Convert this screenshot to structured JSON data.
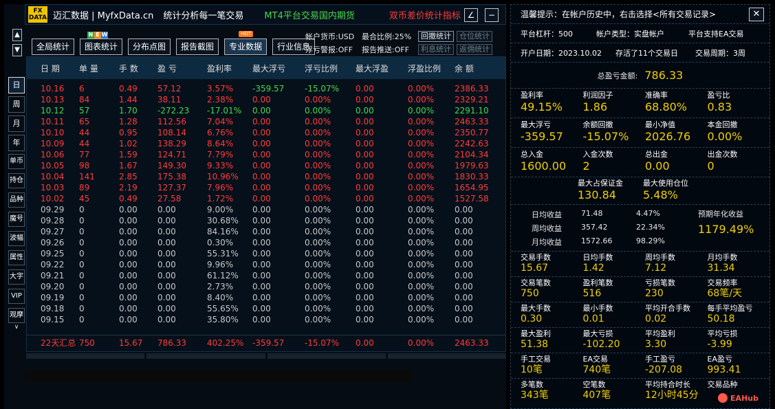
{
  "title": {
    "logo_top": "FX",
    "logo_bottom": "DATA",
    "brand": "迈汇数据 | MyfxData.cn",
    "desc": "统计分析每一笔交易",
    "ad_green": "MT4平台交易国内期货",
    "ad_red": "双币差价统计指标",
    "edit_icon": "∠",
    "minimize_icon": "−"
  },
  "nav_arrows": {
    "up": "▲",
    "down": "▼"
  },
  "toolbar": {
    "new_badge": [
      "N",
      "E",
      "W"
    ],
    "hot_badge": "HOT",
    "buttons": [
      "全局统计",
      "图表统计",
      "分布点图",
      "报告截图",
      "专业数据",
      "行业信息"
    ]
  },
  "account": {
    "currency": "帐户货币:USD",
    "ratio": "最合比例:25%",
    "float_alert": "浮亏警报:OFF",
    "report_push": "报告推送:OFF",
    "btn_withdraw": "回撤统计",
    "btn_position": "仓位统计",
    "btn_interest": "利息统计",
    "btn_rebate": "返佣统计"
  },
  "left_tabs": [
    "日",
    "周",
    "月",
    "年",
    "单币",
    "持仓",
    "品种",
    "魔号",
    "波幅",
    "属性",
    "大字",
    "VIP",
    "观摩",
    "∨"
  ],
  "table": {
    "headers": [
      "日 期",
      "单 量",
      "手 数",
      "盈 亏",
      "盈利率",
      "最大浮亏",
      "浮亏比例",
      "最大浮盈",
      "浮盈比例",
      "余 额"
    ],
    "rows": [
      {
        "s": "pos",
        "c": [
          "10.16",
          "6",
          "0.49",
          "57.12",
          "3.57%",
          "-359.57",
          "-15.07%",
          "0.00",
          "0.00%",
          "2386.33"
        ]
      },
      {
        "s": "pos",
        "c": [
          "10.13",
          "84",
          "1.44",
          "38.11",
          "2.38%",
          "0.00",
          "0.00%",
          "0.00",
          "0.00%",
          "2329.21"
        ]
      },
      {
        "s": "neg",
        "c": [
          "10.12",
          "57",
          "1.70",
          "-272.23",
          "-17.01%",
          "0.00",
          "0.00%",
          "0.00",
          "0.00%",
          "2291.10"
        ]
      },
      {
        "s": "pos",
        "c": [
          "10.11",
          "65",
          "1.28",
          "112.56",
          "7.04%",
          "0.00",
          "0.00%",
          "0.00",
          "0.00%",
          "2463.33"
        ]
      },
      {
        "s": "pos",
        "c": [
          "10.10",
          "44",
          "0.95",
          "108.14",
          "6.76%",
          "0.00",
          "0.00%",
          "0.00",
          "0.00%",
          "2350.77"
        ]
      },
      {
        "s": "pos",
        "c": [
          "10.09",
          "44",
          "1.02",
          "138.29",
          "8.64%",
          "0.00",
          "0.00%",
          "0.00",
          "0.00%",
          "2242.63"
        ]
      },
      {
        "s": "pos",
        "c": [
          "10.06",
          "77",
          "1.59",
          "124.71",
          "7.79%",
          "0.00",
          "0.00%",
          "0.00",
          "0.00%",
          "2104.34"
        ]
      },
      {
        "s": "pos",
        "c": [
          "10.05",
          "98",
          "1.67",
          "149.30",
          "9.33%",
          "0.00",
          "0.00%",
          "0.00",
          "0.00%",
          "1979.63"
        ]
      },
      {
        "s": "pos",
        "c": [
          "10.04",
          "141",
          "2.85",
          "175.38",
          "10.96%",
          "0.00",
          "0.00%",
          "0.00",
          "0.00%",
          "1830.33"
        ]
      },
      {
        "s": "pos",
        "c": [
          "10.03",
          "89",
          "2.19",
          "127.37",
          "7.96%",
          "0.00",
          "0.00%",
          "0.00",
          "0.00%",
          "1654.95"
        ]
      },
      {
        "s": "pos",
        "c": [
          "10.02",
          "45",
          "0.49",
          "27.58",
          "1.72%",
          "0.00",
          "0.00%",
          "0.00",
          "0.00%",
          "1527.58"
        ]
      },
      {
        "s": "neu",
        "c": [
          "09.29",
          "0",
          "0.00",
          "0.00",
          "9.00%",
          "0.00",
          "0.00%",
          "0.00",
          "0.00%",
          "0.00"
        ]
      },
      {
        "s": "neu",
        "c": [
          "09.28",
          "0",
          "0.00",
          "0.00",
          "30.68%",
          "0.00",
          "0.00%",
          "0.00",
          "0.00%",
          "0.00"
        ]
      },
      {
        "s": "neu",
        "c": [
          "09.27",
          "0",
          "0.00",
          "0.00",
          "84.16%",
          "0.00",
          "0.00%",
          "0.00",
          "0.00%",
          "0.00"
        ]
      },
      {
        "s": "neu",
        "c": [
          "09.26",
          "0",
          "0.00",
          "0.00",
          "0.30%",
          "0.00",
          "0.00%",
          "0.00",
          "0.00%",
          "0.00"
        ]
      },
      {
        "s": "neu",
        "c": [
          "09.25",
          "0",
          "0.00",
          "0.00",
          "55.31%",
          "0.00",
          "0.00%",
          "0.00",
          "0.00%",
          "0.00"
        ]
      },
      {
        "s": "neu",
        "c": [
          "09.22",
          "0",
          "0.00",
          "0.00",
          "9.96%",
          "0.00",
          "0.00%",
          "0.00",
          "0.00%",
          "0.00"
        ]
      },
      {
        "s": "neu",
        "c": [
          "09.21",
          "0",
          "0.00",
          "0.00",
          "61.12%",
          "0.00",
          "0.00%",
          "0.00",
          "0.00%",
          "0.00"
        ]
      },
      {
        "s": "neu",
        "c": [
          "09.20",
          "0",
          "0.00",
          "0.00",
          "2.73%",
          "0.00",
          "0.00%",
          "0.00",
          "0.00%",
          "0.00"
        ]
      },
      {
        "s": "neu",
        "c": [
          "09.19",
          "0",
          "0.00",
          "0.00",
          "8.40%",
          "0.00",
          "0.00%",
          "0.00",
          "0.00%",
          "0.00"
        ]
      },
      {
        "s": "neu",
        "c": [
          "09.18",
          "0",
          "0.00",
          "0.00",
          "55.65%",
          "0.00",
          "0.00%",
          "0.00",
          "0.00%",
          "0.00"
        ]
      },
      {
        "s": "neu",
        "c": [
          "09.15",
          "0",
          "0.00",
          "0.00",
          "35.80%",
          "0.00",
          "0.00%",
          "0.00",
          "0.00%",
          "0.00"
        ]
      }
    ],
    "summary": [
      "22天汇总",
      "750",
      "15.67",
      "786.33",
      "402.25%",
      "-359.57",
      "-15.07%",
      "0.00",
      "0.00%",
      "2463.33"
    ]
  },
  "right": {
    "tip": "温馨提示：在帐户历史中，右击选择<所有交易记录>",
    "close_icon": "✕",
    "leverage": "平台杠杆：500",
    "acct_type": "帐户类型：实盘帐户",
    "ea_support": "平台支持EA交易",
    "open_date": "开户日期：2023.10.02",
    "survive": "存活了11个交易日",
    "period": "交易周期：3周",
    "total_label": "总盈亏金额:",
    "total_value": "786.33",
    "stats1": [
      {
        "k": "盈利率",
        "v": "49.15%"
      },
      {
        "k": "利润因子",
        "v": "1.86"
      },
      {
        "k": "准确率",
        "v": "68.80%"
      },
      {
        "k": "盈亏比",
        "v": "0.83"
      }
    ],
    "stats2": [
      {
        "k": "最大浮亏",
        "v": "-359.57"
      },
      {
        "k": "余额回撤",
        "v": "-15.07%"
      },
      {
        "k": "最小净值",
        "v": "2026.76"
      },
      {
        "k": "本金回撤",
        "v": "0.00%"
      }
    ],
    "stats3": [
      {
        "k": "总入金",
        "v": "1600.00"
      },
      {
        "k": "入金次数",
        "v": "2"
      },
      {
        "k": "总出金",
        "v": "0.00"
      },
      {
        "k": "出金次数",
        "v": "0"
      }
    ],
    "stats4": [
      {
        "k": "最大占保证金",
        "v": "130.84"
      },
      {
        "k": "最大使用仓位",
        "v": "5.48%"
      }
    ],
    "avg": [
      {
        "k": "日均收益",
        "a": "71.48",
        "b": "4.47%"
      },
      {
        "k": "周均收益",
        "a": "357.42",
        "b": "22.34%"
      },
      {
        "k": "月均收益",
        "a": "1572.66",
        "b": "98.29%"
      }
    ],
    "proj_label": "预期年化收益",
    "proj_value": "1179.49%",
    "stats5": [
      {
        "k": "交易手数",
        "v": "15.67"
      },
      {
        "k": "日均手数",
        "v": "1.42"
      },
      {
        "k": "周均手数",
        "v": "7.12"
      },
      {
        "k": "月均手数",
        "v": "31.34"
      }
    ],
    "stats6": [
      {
        "k": "交易笔数",
        "v": "750"
      },
      {
        "k": "盈利笔数",
        "v": "516"
      },
      {
        "k": "亏损笔数",
        "v": "230"
      },
      {
        "k": "交易频率",
        "v": "68笔/天"
      }
    ],
    "stats7": [
      {
        "k": "最大手数",
        "v": "0.30"
      },
      {
        "k": "最小手数",
        "v": "0.01"
      },
      {
        "k": "平均开合手数",
        "v": "0.02"
      },
      {
        "k": "每手平均盈亏",
        "v": "50.18"
      }
    ],
    "stats8": [
      {
        "k": "最大盈利",
        "v": "51.38"
      },
      {
        "k": "最大亏损",
        "v": "-102.20"
      },
      {
        "k": "平均盈利",
        "v": "3.30"
      },
      {
        "k": "平均亏损",
        "v": "-3.99"
      }
    ],
    "stats9": [
      {
        "k": "手工交易",
        "v": "10笔"
      },
      {
        "k": "EA交易",
        "v": "740笔"
      },
      {
        "k": "手工盈亏",
        "v": "-207.08"
      },
      {
        "k": "EA盈亏",
        "v": "993.41"
      }
    ],
    "stats10": [
      {
        "k": "多笔数",
        "v": "343笔"
      },
      {
        "k": "空笔数",
        "v": "407笔"
      },
      {
        "k": "平均持合时长",
        "v": "12小时45分"
      },
      {
        "k": "交易品种",
        "v": ""
      }
    ],
    "watermark": "EAHub"
  }
}
